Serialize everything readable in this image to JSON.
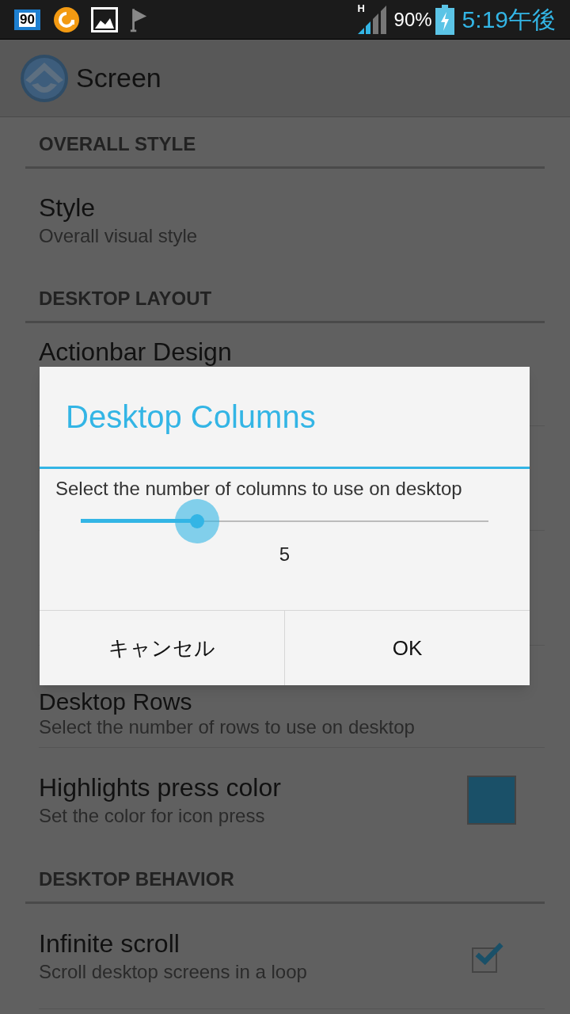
{
  "status_bar": {
    "badge_text": "90",
    "network": "H",
    "battery": "90%",
    "time": "5:19午後"
  },
  "action_bar": {
    "title": "Screen"
  },
  "sections": [
    {
      "header": "OVERALL STYLE",
      "items": [
        {
          "kind": "plain",
          "title": "Style",
          "subtitle": "Overall visual style"
        }
      ]
    },
    {
      "header": "DESKTOP LAYOUT",
      "items": [
        {
          "kind": "partial_top",
          "title": "Actionbar Design"
        },
        {
          "kind": "partial_bottom",
          "title": "Desktop Rows",
          "subtitle": "Select the number of rows to use on desktop"
        },
        {
          "kind": "color",
          "title": "Highlights press color",
          "subtitle": "Set the color for icon press",
          "color": "#1a5068"
        }
      ]
    },
    {
      "header": "DESKTOP BEHAVIOR",
      "items": [
        {
          "kind": "checkbox",
          "title": "Infinite scroll",
          "subtitle": "Scroll desktop screens in a loop",
          "checked": true
        }
      ]
    }
  ],
  "dialog": {
    "title": "Desktop Columns",
    "message": "Select the number of columns to use on desktop",
    "slider": {
      "level": 0.285
    },
    "value": "5",
    "buttons": [
      "キャンセル",
      "OK"
    ]
  }
}
